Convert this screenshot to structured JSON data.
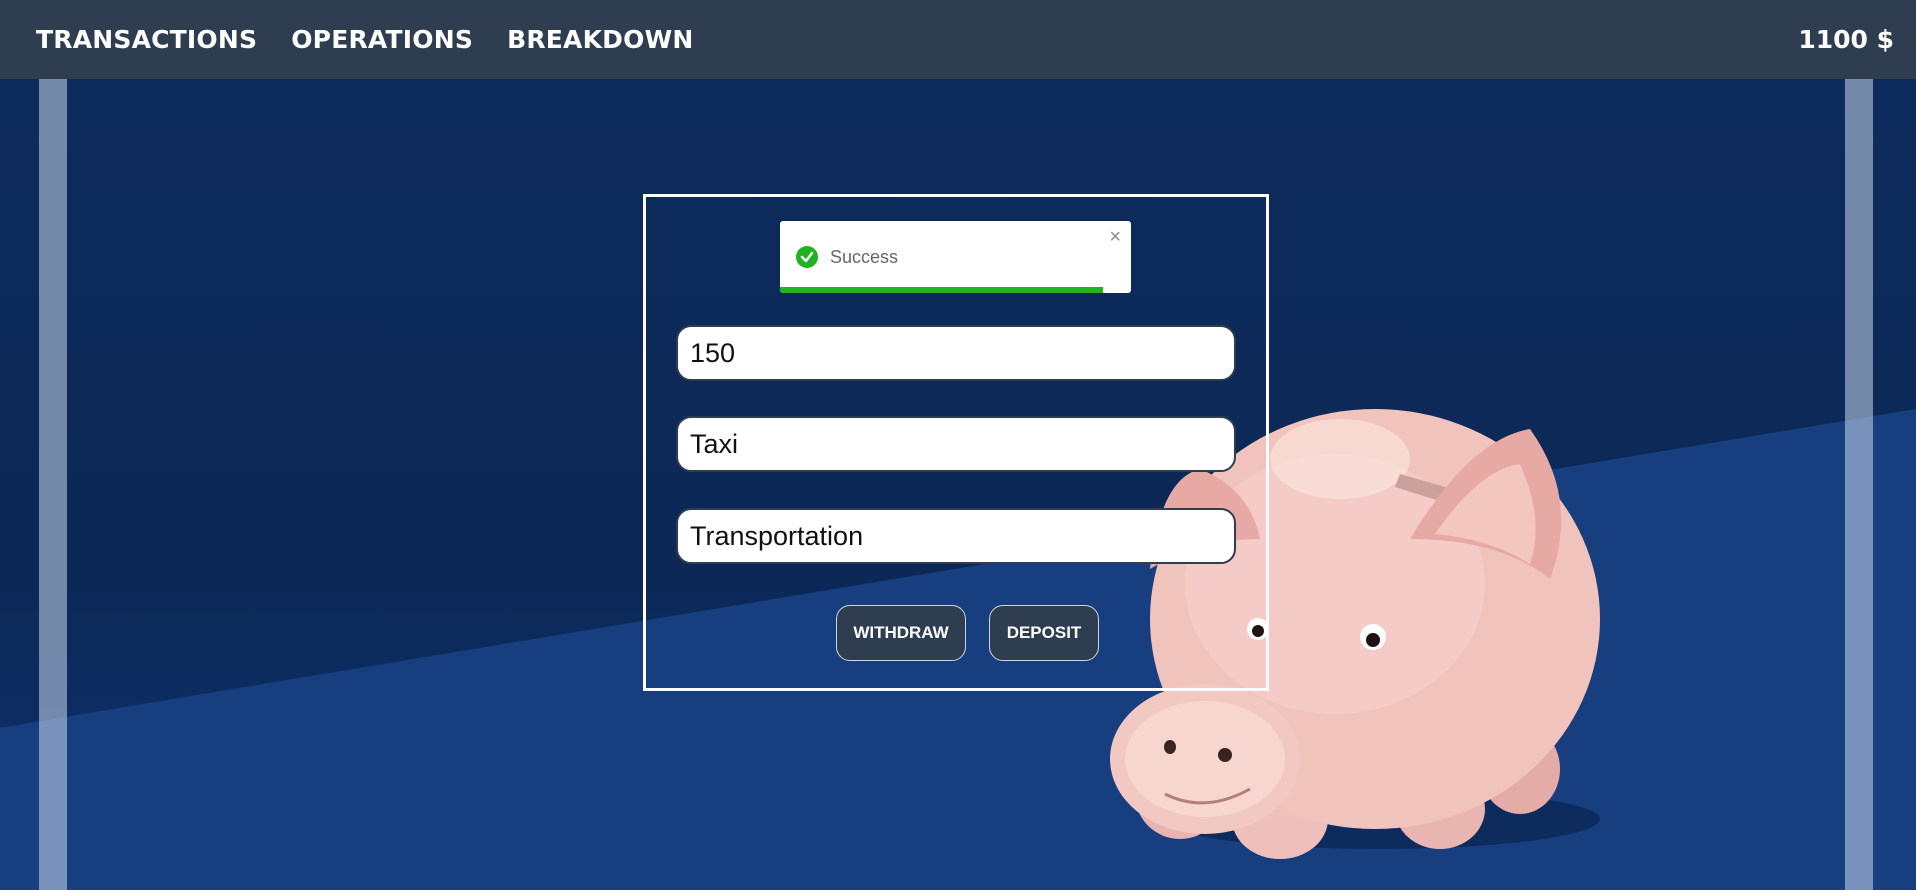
{
  "nav": {
    "links": [
      "TRANSACTIONS",
      "OPERATIONS",
      "BREAKDOWN"
    ],
    "balance": "1100 $"
  },
  "toast": {
    "message": "Success",
    "close": "×",
    "status_color": "#1fb31f",
    "progress_percent": 92
  },
  "form": {
    "amount": "150",
    "description": "Taxi",
    "category": "Transportation",
    "withdraw_label": "WITHDRAW",
    "deposit_label": "DEPOSIT"
  },
  "icons": {
    "success": "check-circle-icon",
    "close": "close-icon"
  },
  "colors": {
    "navbar": "#2e3d4f",
    "background": "#0c2a5a",
    "button": "#2e3d4f"
  }
}
